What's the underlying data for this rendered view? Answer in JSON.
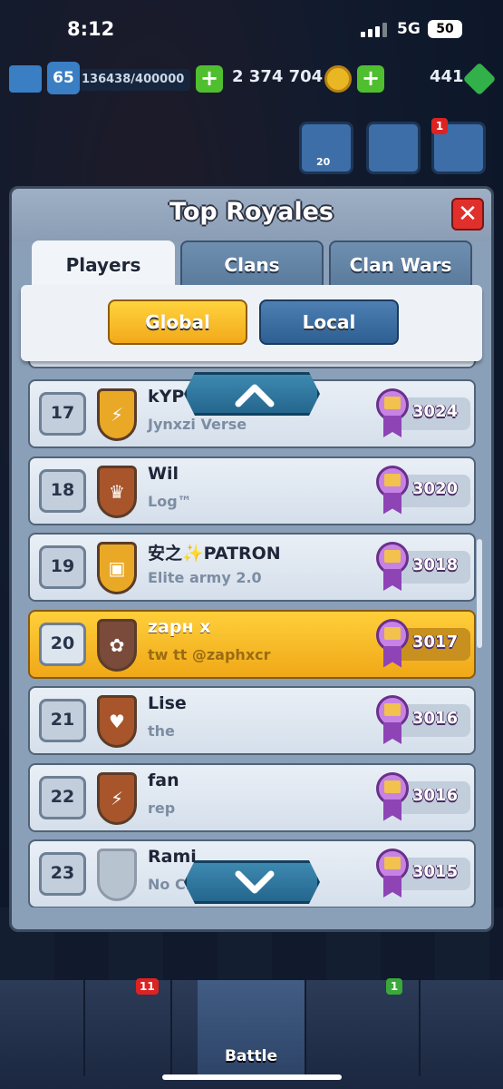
{
  "status_bar": {
    "time": "8:12",
    "network": "5G",
    "battery": "50"
  },
  "hud": {
    "level": "65",
    "xp": "136438/400000",
    "gold": "2 374 704",
    "gems": "441"
  },
  "side_buttons": {
    "friends_count": "20",
    "menu_notification": "1"
  },
  "dialog": {
    "title": "Top Royales",
    "close_label": "✕",
    "tabs": [
      {
        "label": "Players",
        "active": true
      },
      {
        "label": "Clans",
        "active": false
      },
      {
        "label": "Clan Wars",
        "active": false
      }
    ],
    "filters": {
      "global": "Global",
      "local": "Local"
    },
    "rows": [
      {
        "rank": "17",
        "name": "kYP",
        "clan": "Jynxzi Verse",
        "trophies": "3024",
        "badge": "lightning",
        "badge_color": "#e9a825",
        "highlight": false
      },
      {
        "rank": "18",
        "name": "Wil",
        "clan": "Log™",
        "trophies": "3020",
        "badge": "crown",
        "badge_color": "#a8552c",
        "highlight": false
      },
      {
        "rank": "19",
        "name": "安之✨PATRON",
        "clan": "Elite army 2.0",
        "trophies": "3018",
        "badge": "chest",
        "badge_color": "#e9a825",
        "highlight": false
      },
      {
        "rank": "20",
        "name": "zapн x",
        "clan": "tw tt @zaphxcr",
        "trophies": "3017",
        "badge": "lotus",
        "badge_color": "#7a4a3a",
        "highlight": true
      },
      {
        "rank": "21",
        "name": "Lise",
        "clan": "the",
        "trophies": "3016",
        "badge": "heart",
        "badge_color": "#a8552c",
        "highlight": false
      },
      {
        "rank": "22",
        "name": "fan",
        "clan": "rep",
        "trophies": "3016",
        "badge": "lightning",
        "badge_color": "#a8552c",
        "highlight": false
      },
      {
        "rank": "23",
        "name": "Rami",
        "clan": "No Cl",
        "trophies": "3015",
        "badge": "empty",
        "badge_color": "#b8c3d0",
        "highlight": false
      }
    ]
  },
  "bottom_nav": {
    "cards_notification": "11",
    "clan_notification": "1",
    "battle_label": "Battle"
  },
  "colors": {
    "highlight": "#f6bb27",
    "row": "#e3eaf3",
    "local_button": "#3a6fa5",
    "global_button": "#f6bf2b"
  }
}
